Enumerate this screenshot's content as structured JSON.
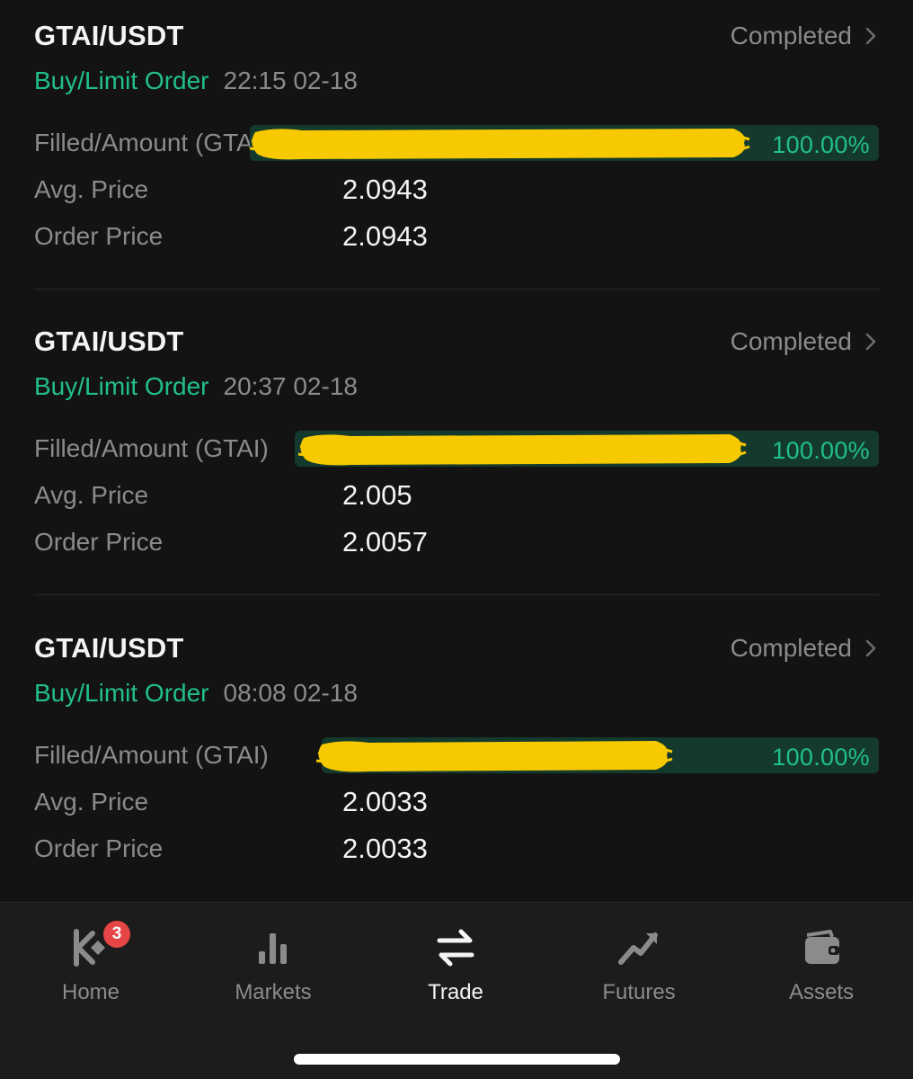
{
  "orders": [
    {
      "pair": "GTAI/USDT",
      "status": "Completed",
      "side": "Buy/Limit Order",
      "time": "22:15 02-18",
      "filled_label": "Filled/Amount (GTA",
      "filled_pct": "100.00%",
      "progress": 1.0,
      "avg_label": "Avg. Price",
      "avg_price": "2.0943",
      "order_label": "Order Price",
      "order_price": "2.0943"
    },
    {
      "pair": "GTAI/USDT",
      "status": "Completed",
      "side": "Buy/Limit Order",
      "time": "20:37 02-18",
      "filled_label": "Filled/Amount (GTAI)",
      "filled_pct": "100.00%",
      "progress": 1.0,
      "avg_label": "Avg. Price",
      "avg_price": "2.005",
      "order_label": "Order Price",
      "order_price": "2.0057"
    },
    {
      "pair": "GTAI/USDT",
      "status": "Completed",
      "side": "Buy/Limit Order",
      "time": "08:08 02-18",
      "filled_label": "Filled/Amount (GTAI)",
      "filled_pct": "100.00%",
      "progress": 1.0,
      "avg_label": "Avg. Price",
      "avg_price": "2.0033",
      "order_label": "Order Price",
      "order_price": "2.0033"
    }
  ],
  "nav": {
    "home": {
      "label": "Home",
      "icon": "kucoin-logo-icon",
      "badge": "3"
    },
    "markets": {
      "label": "Markets",
      "icon": "bar-chart-icon"
    },
    "trade": {
      "label": "Trade",
      "icon": "swap-arrows-icon"
    },
    "futures": {
      "label": "Futures",
      "icon": "trend-up-icon"
    },
    "assets": {
      "label": "Assets",
      "icon": "wallet-icon"
    }
  },
  "colors": {
    "background": "#131313",
    "accent_green": "#21c087",
    "muted_text": "#8b8b8b",
    "primary_text": "#f4f4f4",
    "redaction": "#f7c900",
    "badge_red": "#e64545"
  }
}
